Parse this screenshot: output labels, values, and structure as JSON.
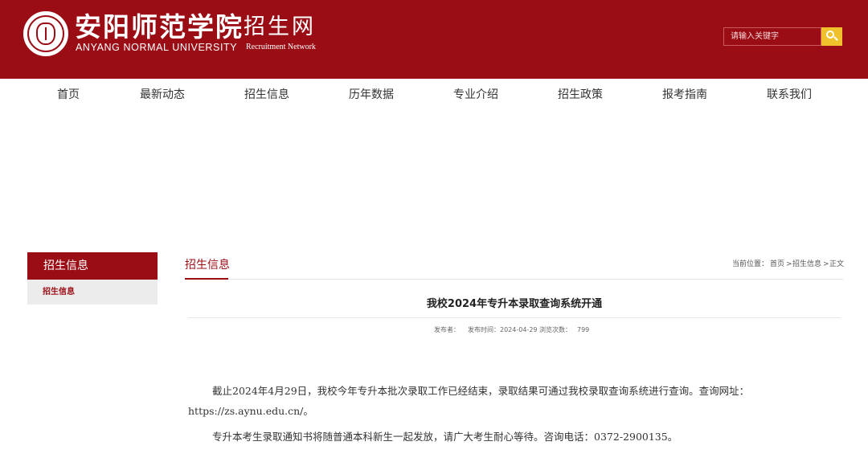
{
  "header": {
    "site_name_cn": "安阳师范学院",
    "site_subtitle_cn": "招生网",
    "site_name_en": "ANYANG NORMAL UNIVERSITY",
    "site_subtitle_en": "Recruitment Network",
    "search_placeholder": "请输入关键字",
    "brand_color": "#9b0d15",
    "search_button_color": "#f0c12c"
  },
  "nav": {
    "items": [
      "首页",
      "最新动态",
      "招生信息",
      "历年数据",
      "专业介绍",
      "招生政策",
      "报考指南",
      "联系我们"
    ]
  },
  "sidebar": {
    "title": "招生信息",
    "items": [
      "招生信息"
    ]
  },
  "main": {
    "section_title": "招生信息",
    "breadcrumb": {
      "prefix": "当前位置：",
      "home": "首页",
      "sep1": ">",
      "category": "招生信息",
      "sep2": ">",
      "current": "正文"
    },
    "article": {
      "title": "我校2024年专升本录取查询系统开通",
      "publisher_label": "发布者：",
      "publisher": "",
      "date_label": "发布时间：",
      "date": "2024-04-29",
      "views_label": "浏览次数：",
      "views": "799",
      "paragraph1_line1": "截止2024年4月29日，我校今年专升本批次录取工作已经结束，录取结果可通过我校录取查询系统进行查询。查询网址：",
      "paragraph1_line2": "https://zs.aynu.edu.cn/。",
      "paragraph2": "专升本考生录取通知书将随普通本科新生一起发放，请广大考生耐心等待。咨询电话：0372-2900135。"
    }
  }
}
